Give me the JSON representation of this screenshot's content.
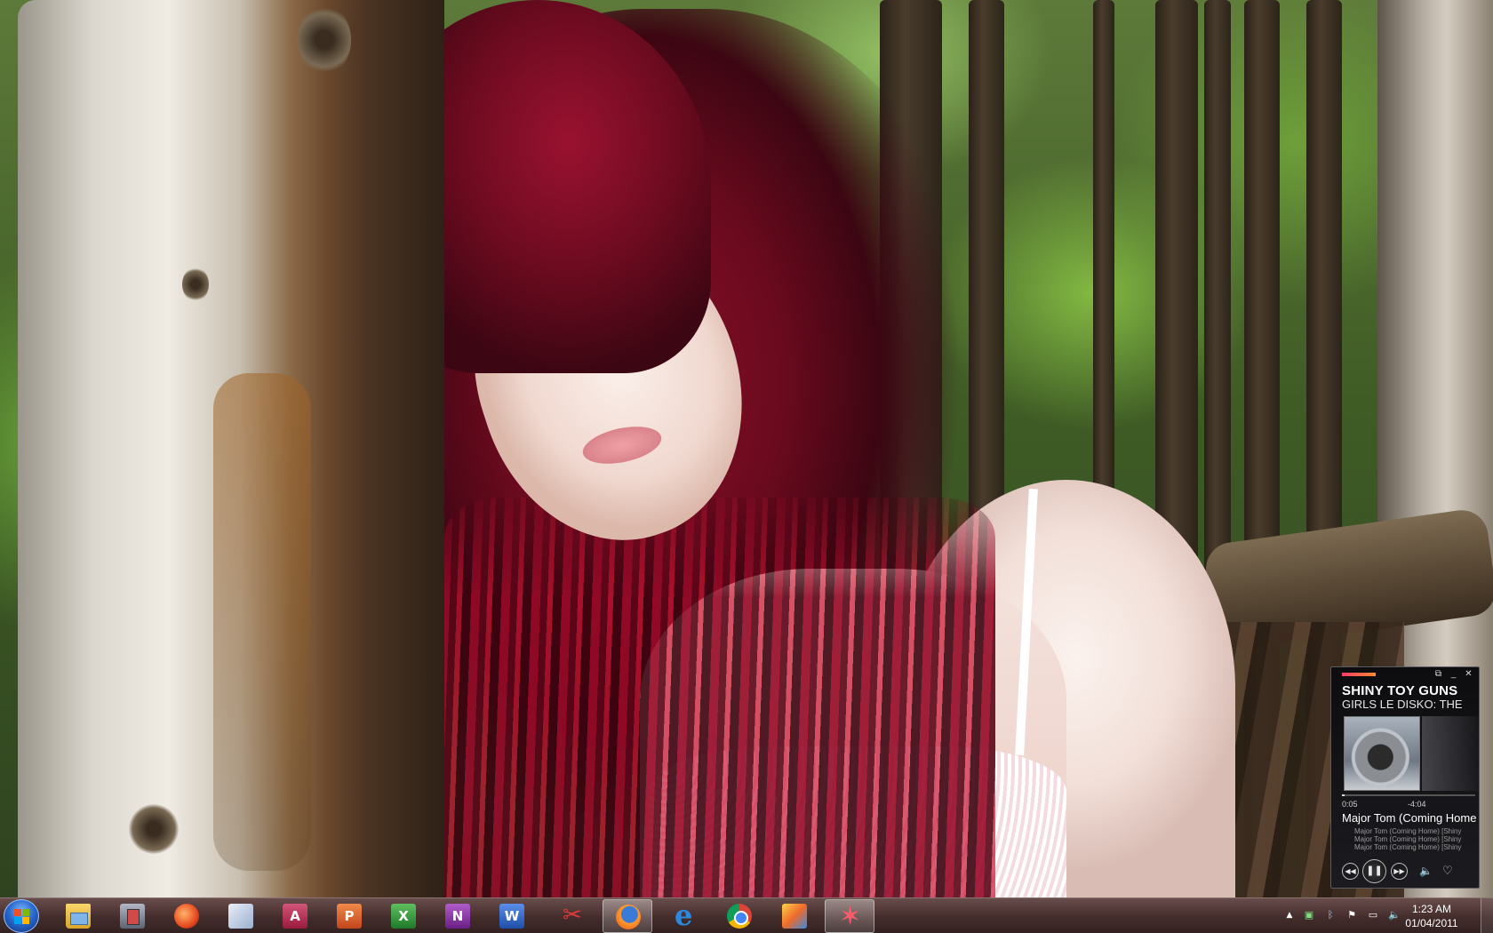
{
  "media_player": {
    "artist": "SHINY TOY GUNS",
    "album": "GIRLS LE DISKO: THE",
    "elapsed": "0:05",
    "remaining": "-4:04",
    "progress": 0.02,
    "now_playing": "Major Tom (Coming Home",
    "queue": [
      "Major Tom (Coming Home) [Shiny",
      "Major Tom (Coming Home) [Shiny",
      "Major Tom (Coming Home) [Shiny"
    ],
    "accent_color": "#ff3a6a"
  },
  "taskbar": {
    "pinned_apps": [
      {
        "name": "windows-explorer",
        "icon": "folder-icon"
      },
      {
        "name": "media-center",
        "icon": "media-icon"
      },
      {
        "name": "zune",
        "icon": "zune-icon"
      },
      {
        "name": "lync",
        "icon": "lync-icon"
      },
      {
        "name": "access",
        "icon": "access-icon",
        "glyph": "A"
      },
      {
        "name": "powerpoint",
        "icon": "powerpoint-icon",
        "glyph": "P"
      },
      {
        "name": "excel",
        "icon": "excel-icon",
        "glyph": "X"
      },
      {
        "name": "onenote",
        "icon": "onenote-icon",
        "glyph": "N"
      },
      {
        "name": "word",
        "icon": "word-icon",
        "glyph": "W"
      },
      {
        "name": "snipping-tool",
        "icon": "scissors-icon"
      },
      {
        "name": "firefox",
        "icon": "firefox-icon",
        "active": true
      },
      {
        "name": "internet-explorer",
        "icon": "ie-icon"
      },
      {
        "name": "chrome",
        "icon": "chrome-icon"
      },
      {
        "name": "paint-app",
        "icon": "paint-icon"
      },
      {
        "name": "star-app",
        "icon": "star-icon",
        "active": true
      }
    ],
    "clock": {
      "time": "1:23 AM",
      "date": "01/04/2011"
    },
    "tray_icons": [
      "show-hidden-icons-arrow",
      "network-icon",
      "bluetooth-icon",
      "action-center-flag-icon",
      "power-icon",
      "volume-icon"
    ],
    "tint_color": "#4a2e2e"
  }
}
